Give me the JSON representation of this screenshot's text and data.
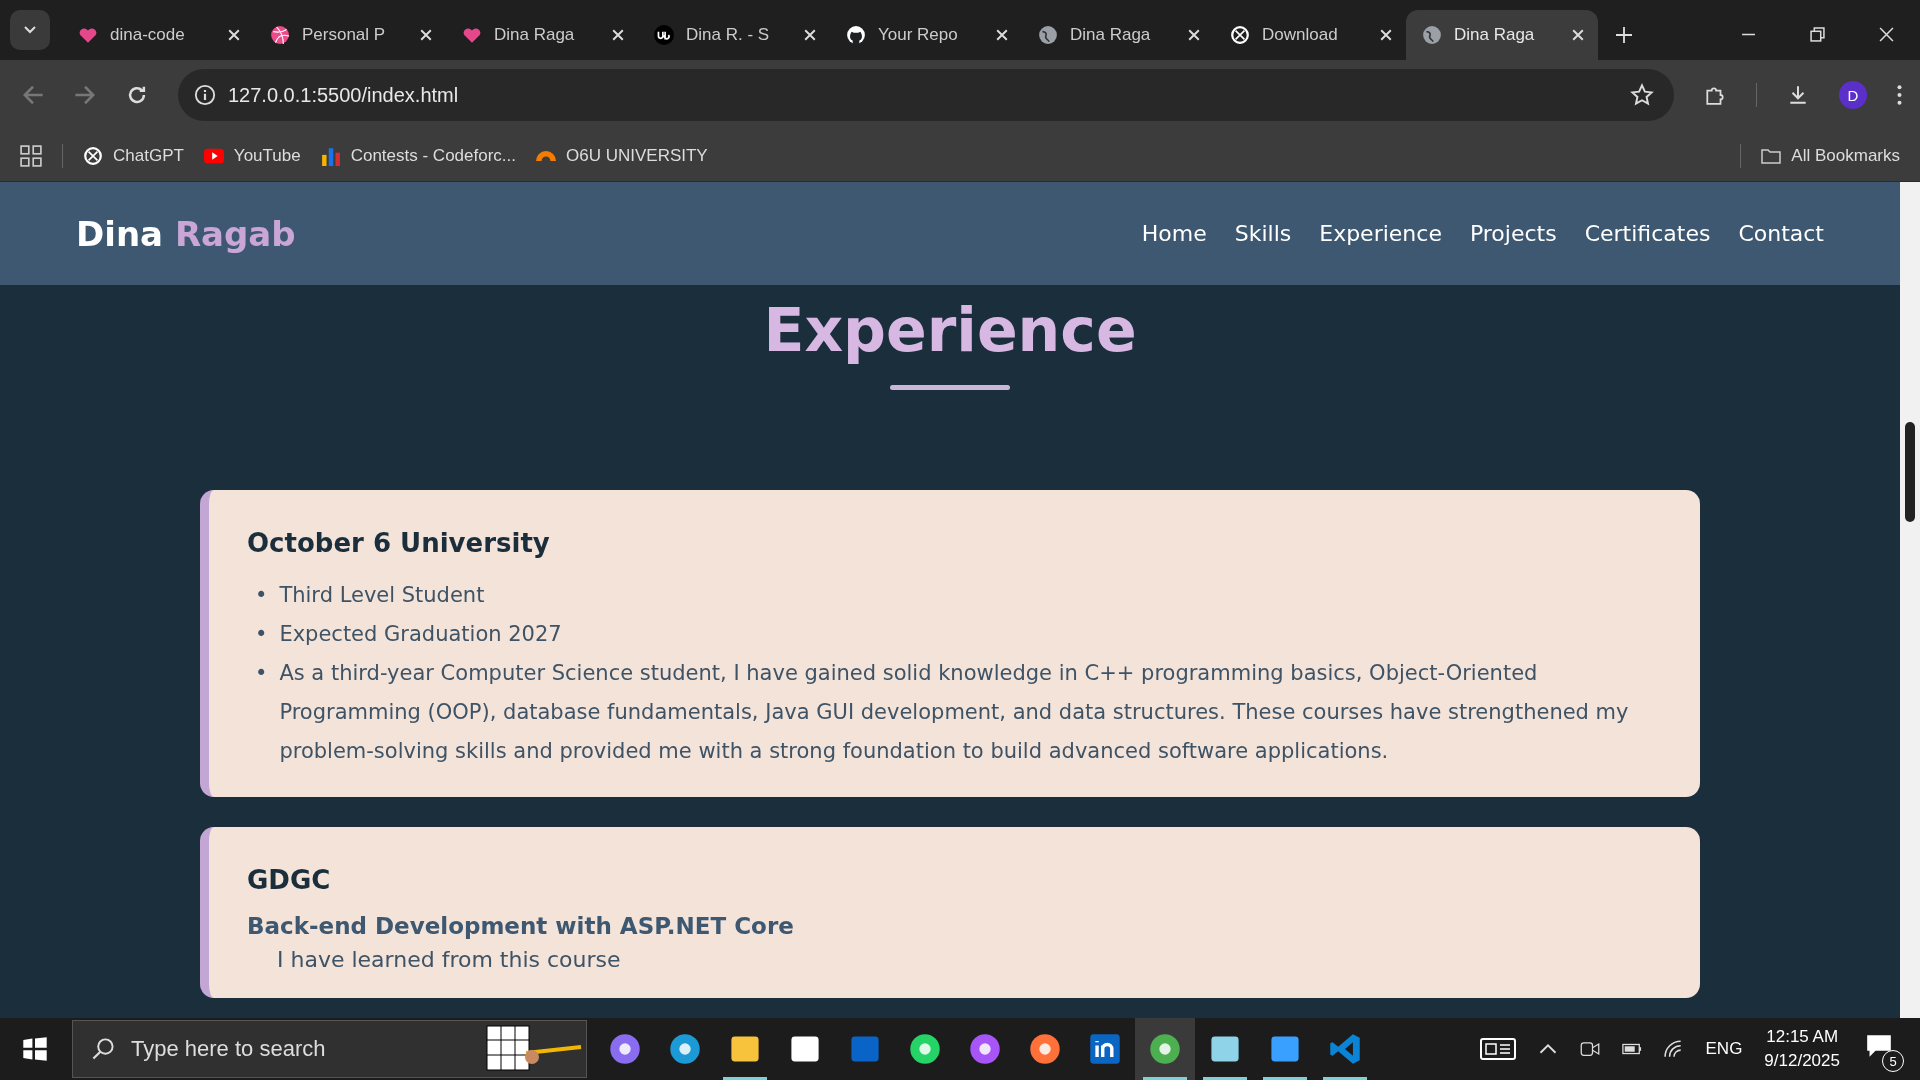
{
  "browser": {
    "tabs": [
      {
        "title": "dina-code",
        "kind": "heart",
        "selected": false
      },
      {
        "title": "Personal P",
        "kind": "dribbble",
        "selected": false
      },
      {
        "title": "Dina Raga",
        "kind": "heart",
        "selected": false
      },
      {
        "title": "Dina R. - S",
        "kind": "upwork",
        "selected": false
      },
      {
        "title": "Your Repo",
        "kind": "github",
        "selected": false
      },
      {
        "title": "Dina Raga",
        "kind": "globe",
        "selected": false
      },
      {
        "title": "Download",
        "kind": "openai",
        "selected": false
      },
      {
        "title": "Dina Raga",
        "kind": "globe",
        "selected": true
      }
    ],
    "url": "127.0.0.1:5500/index.html",
    "profile_initial": "D",
    "bookmarks": [
      {
        "label": "ChatGPT",
        "kind": "openai"
      },
      {
        "label": "YouTube",
        "kind": "youtube"
      },
      {
        "label": "Contests - Codeforc...",
        "kind": "bars"
      },
      {
        "label": "O6U UNIVERSITY",
        "kind": "arc"
      }
    ],
    "all_bookmarks": "All Bookmarks"
  },
  "site": {
    "brand_first": "Dina",
    "brand_second": "Ragab",
    "nav": [
      "Home",
      "Skills",
      "Experience",
      "Projects",
      "Certificates",
      "Contact"
    ],
    "section_title": "Experience",
    "cards": [
      {
        "title": "October 6 University",
        "marker": "•",
        "bullets": [
          "Third Level Student",
          "Expected Graduation 2027",
          "As a third-year Computer Science student, I have gained solid knowledge in C++ programming basics, Object-Oriented Programming (OOP), database fundamentals, Java GUI development, and data structures. These courses have strengthened my problem-solving skills and provided me with a strong foundation to build advanced software applications."
        ]
      },
      {
        "title": "GDGC",
        "subtitle": "Back-end Development with ASP.NET Core",
        "note": "I have learned from this course"
      }
    ]
  },
  "taskbar": {
    "search_placeholder": "Type here to search",
    "apps": [
      {
        "kind": "copilot",
        "running": false,
        "selected": false
      },
      {
        "kind": "edge",
        "running": false,
        "selected": false
      },
      {
        "kind": "explorer",
        "running": true,
        "selected": false
      },
      {
        "kind": "store",
        "running": false,
        "selected": false
      },
      {
        "kind": "outlook",
        "running": false,
        "selected": false
      },
      {
        "kind": "whatsapp",
        "running": false,
        "selected": false
      },
      {
        "kind": "messenger",
        "running": false,
        "selected": false
      },
      {
        "kind": "firefox",
        "running": false,
        "selected": false
      },
      {
        "kind": "linkedin",
        "running": false,
        "selected": false
      },
      {
        "kind": "chrome",
        "running": true,
        "selected": true
      },
      {
        "kind": "notepad",
        "running": true,
        "selected": false
      },
      {
        "kind": "photos",
        "running": true,
        "selected": false
      },
      {
        "kind": "vscode",
        "running": true,
        "selected": false
      }
    ],
    "language": "ENG",
    "time": "12:15 AM",
    "date": "9/12/2025",
    "notifications": "5"
  }
}
